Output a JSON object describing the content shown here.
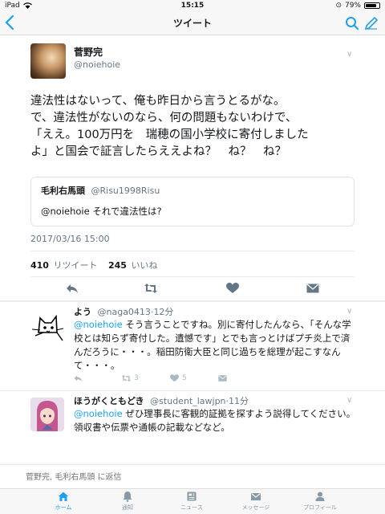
{
  "status_bar": {
    "device": "iPad",
    "time": "15:15",
    "battery": "79%",
    "battery_level": 0.79
  },
  "nav": {
    "title": "ツイート"
  },
  "tweet": {
    "author_name": "菅野完",
    "author_handle": "@noiehoie",
    "text": "違法性はないって、俺も昨日から言うとるがな。\nで、違法性がないのなら、何の問題もないわけで、\n「ええ。100万円を　瑞穂の国小学校に寄付しました\nよ」と国会で証言したらええよね？　ね？　ね？",
    "quote": {
      "name": "毛利右馬頭",
      "handle": "@Risu1998Risu",
      "text": "@noiehoie それで違法性は?"
    },
    "timestamp": "2017/03/16 15:00",
    "retweets": "410",
    "retweets_label": "リツイート",
    "likes": "245",
    "likes_label": "いいね"
  },
  "replies": [
    {
      "name": "よう",
      "handle": "@naga0413",
      "time": "12分",
      "mention": "@noiehoie",
      "text": " そう言うことですね。別に寄付したんなら、「そんな学校とは知らず寄付した。遺憾です」とでも言っとけばプチ炎上で済んだろうに・・・。稲田防衛大臣と同じ過ちを総理が起こすなんて・・・。",
      "retweets": "3",
      "likes": "5"
    },
    {
      "name": "ほうがくともどき",
      "handle": "@student_lawjpn",
      "time": "11分",
      "mention": "@noiehoie",
      "text": " ぜひ理事長に客観的証拠を探すよう説得してください。領収書や伝票や通帳の記載などなど。"
    }
  ],
  "composer": {
    "placeholder": "菅野完, 毛利右馬頭 に返信"
  },
  "tabs": [
    {
      "label": "ホーム",
      "icon": "home-icon",
      "active": true
    },
    {
      "label": "通知",
      "icon": "bell-icon"
    },
    {
      "label": "ニュース",
      "icon": "news-icon"
    },
    {
      "label": "メッセージ",
      "icon": "envelope-icon"
    },
    {
      "label": "プロフィール",
      "icon": "person-icon"
    }
  ],
  "colors": {
    "accent": "#1da1f2",
    "secondary_text": "#657786",
    "icon_gray": "#aab8c2",
    "background": "#f5f8fa"
  }
}
